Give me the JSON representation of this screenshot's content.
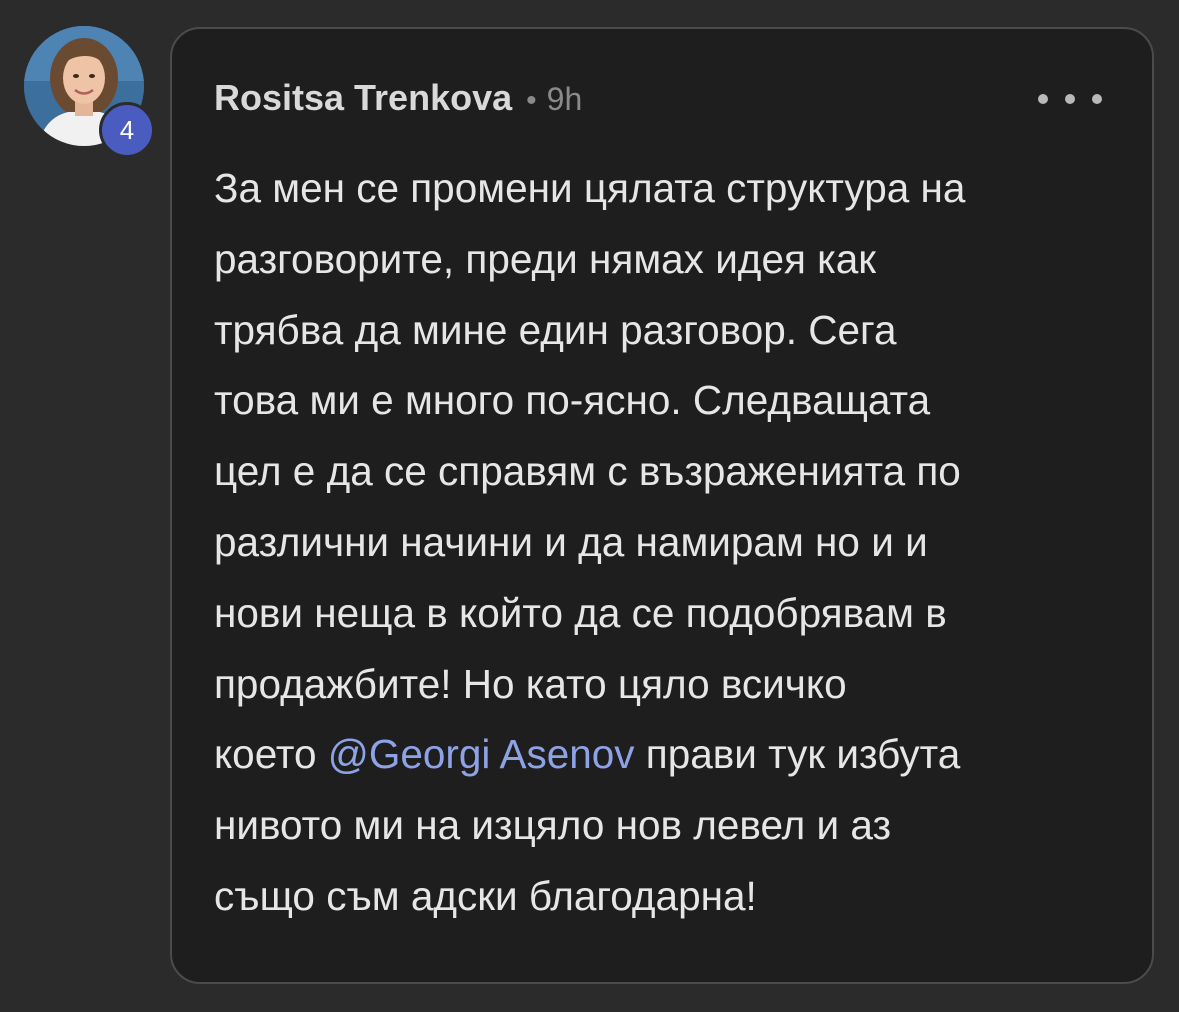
{
  "comment": {
    "author": "Rositsa Trenkova",
    "separator": "•",
    "time": "9h",
    "level_badge": "4",
    "more_label": "•••",
    "body_lines": {
      "l1": "За мен се промени цялата структура на",
      "l2": "разговорите, преди нямах идея как",
      "l3": "трябва да мине един разговор. Сега",
      "l4": "това ми е много по-ясно. Следващата",
      "l5": "цел е да се справям с възраженията по",
      "l6": "различни начини и да намирам но и и",
      "l7": "нови неща в който да се подобрявам в",
      "l8": "продажбите! Но като цяло всичко",
      "l9_before": "което ",
      "l9_mention": "@Georgi Asenov",
      "l9_after": " прави тук избута",
      "l10": "нивото ми на изцяло нов левел и аз",
      "l11": "също съм адски благодарна!"
    }
  },
  "colors": {
    "page_bg": "#2b2b2c",
    "bubble_bg": "#1e1e1f",
    "bubble_border": "#4b4b4d",
    "text": "#e6e6e6",
    "mention": "#8ea2e6",
    "badge": "#4a5cc0"
  },
  "icons": {
    "avatar": "user-photo-avatar",
    "more": "more-horizontal-icon"
  }
}
